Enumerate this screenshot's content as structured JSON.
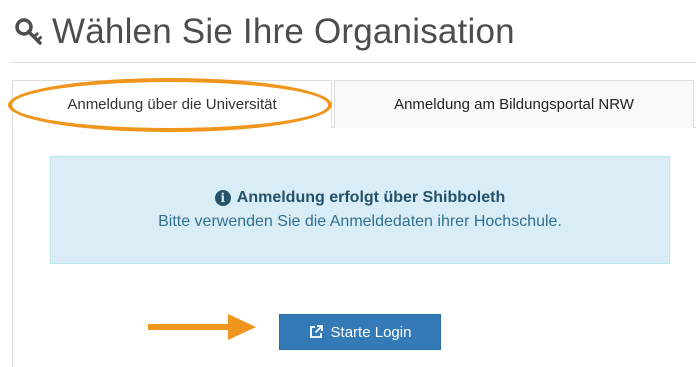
{
  "page": {
    "title": "Wählen Sie Ihre Organisation",
    "title_icon": "key-icon"
  },
  "tabs": [
    {
      "label": "Anmeldung über die Universität",
      "active": true
    },
    {
      "label": "Anmeldung am Bildungsportal NRW",
      "active": false
    }
  ],
  "info_box": {
    "icon": "info-circle-icon",
    "heading": "Anmeldung erfolgt über Shibboleth",
    "text": "Bitte verwenden Sie die Anmeldedaten ihrer Hochschule."
  },
  "login": {
    "icon": "external-link-icon",
    "label": "Starte Login"
  },
  "annotations": {
    "highlight_color": "#f0961c",
    "arrow_icon": "arrow-right-icon"
  },
  "colors": {
    "primary_button": "#337ab7",
    "info_background": "#d9edf7",
    "info_heading": "#245269",
    "info_text": "#31708f"
  }
}
